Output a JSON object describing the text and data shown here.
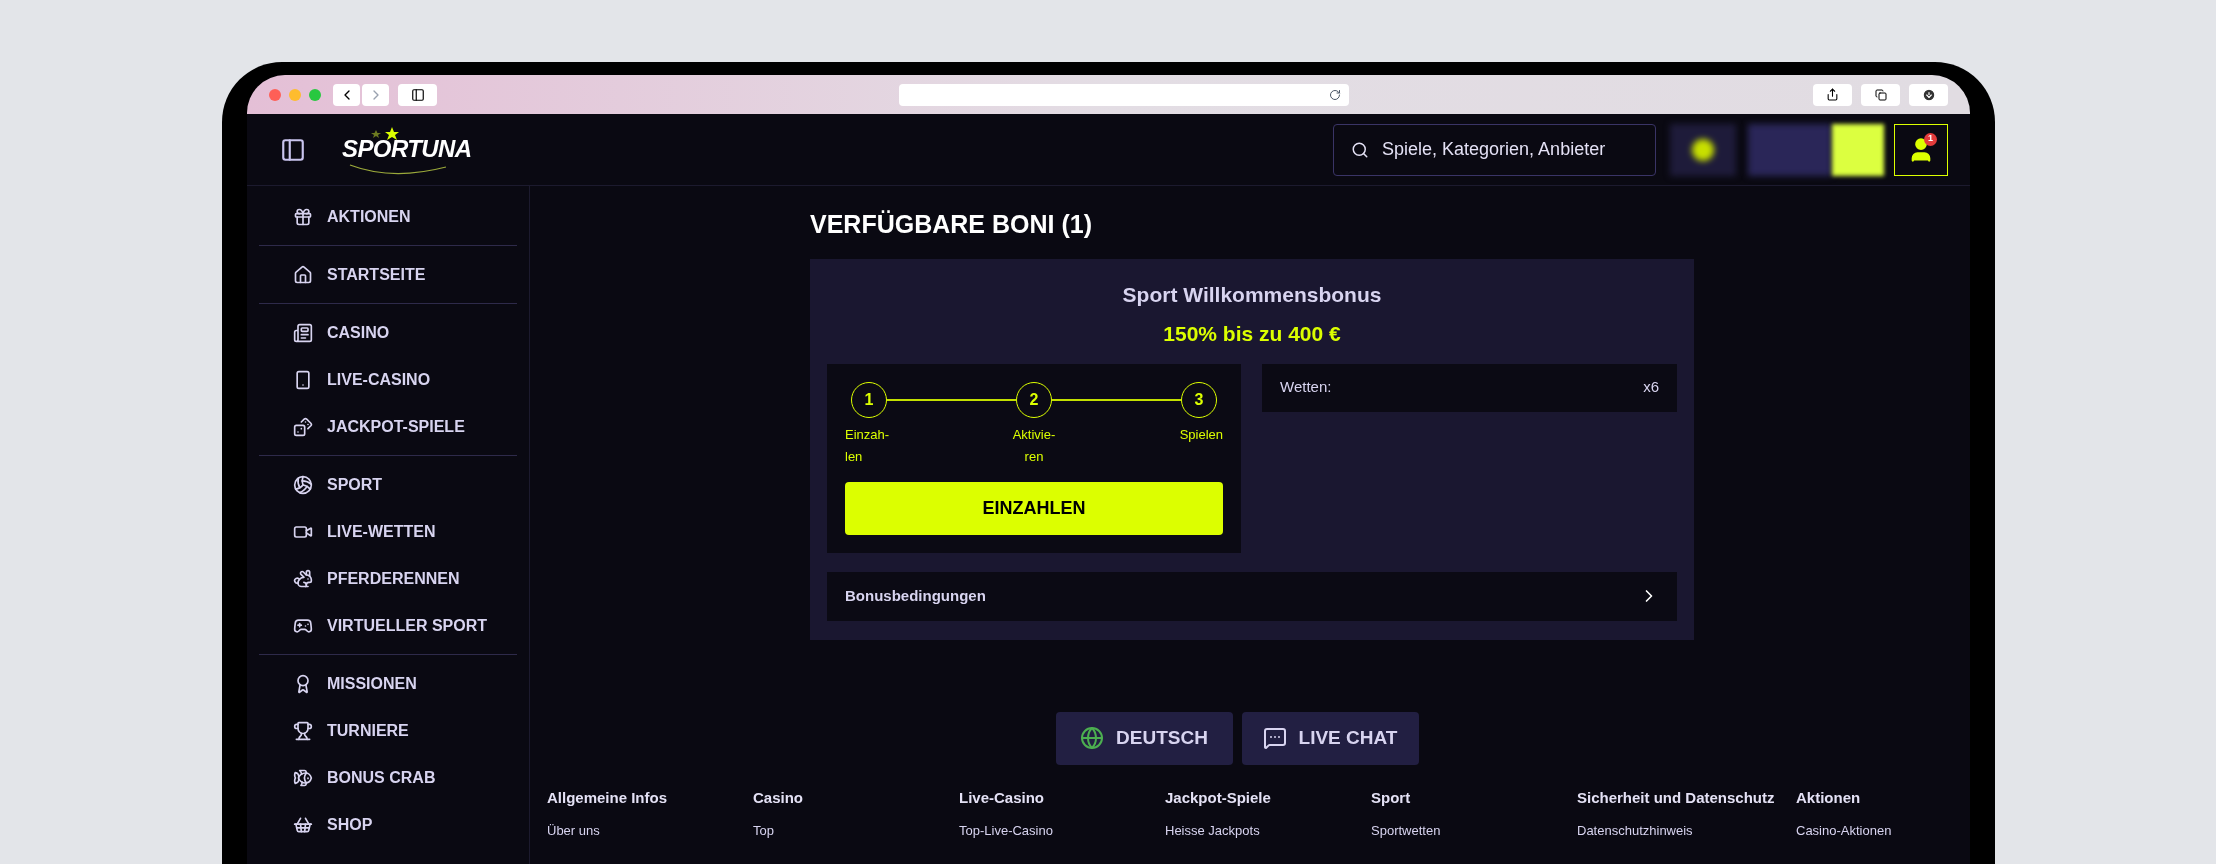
{
  "header": {
    "logo": "SPORTUNA",
    "search": {
      "placeholder": "Spiele, Kategorien, Anbieter"
    },
    "notification_count": "1"
  },
  "sidebar": {
    "groups": [
      {
        "items": [
          {
            "label": "AKTIONEN"
          }
        ]
      },
      {
        "items": [
          {
            "label": "STARTSEITE"
          }
        ]
      },
      {
        "items": [
          {
            "label": "CASINO"
          },
          {
            "label": "LIVE-CASINO"
          },
          {
            "label": "JACKPOT-SPIELE"
          }
        ]
      },
      {
        "items": [
          {
            "label": "SPORT"
          },
          {
            "label": "LIVE-WETTEN"
          },
          {
            "label": "PFERDERENNEN"
          },
          {
            "label": "VIRTUELLER SPORT"
          }
        ]
      },
      {
        "items": [
          {
            "label": "MISSIONEN"
          },
          {
            "label": "TURNIERE"
          },
          {
            "label": "BONUS CRAB"
          },
          {
            "label": "SHOP"
          }
        ]
      }
    ]
  },
  "main": {
    "title": "VERFÜGBARE BONI (1)",
    "bonus": {
      "name": "Sport Willkommensbonus",
      "offer": "150% bis zu 400 €",
      "steps": [
        {
          "number": "1",
          "label": "Einzah-len"
        },
        {
          "number": "2",
          "label": "Aktivie-ren"
        },
        {
          "number": "3",
          "label": "Spielen"
        }
      ],
      "button": "EINZAHLEN",
      "wager_label": "Wetten:",
      "wager_value": "x6",
      "terms": "Bonusbedingungen"
    }
  },
  "footer": {
    "buttons": [
      {
        "kind": "language",
        "label": "DEUTSCH"
      },
      {
        "kind": "chat",
        "label": "LIVE CHAT"
      }
    ],
    "columns": [
      {
        "heading": "Allgemeine Infos",
        "links": [
          "Über uns"
        ]
      },
      {
        "heading": "Casino",
        "links": [
          "Top"
        ]
      },
      {
        "heading": "Live-Casino",
        "links": [
          "Top-Live-Casino"
        ]
      },
      {
        "heading": "Jackpot-Spiele",
        "links": [
          "Heisse Jackpots"
        ]
      },
      {
        "heading": "Sport",
        "links": [
          "Sportwetten"
        ]
      },
      {
        "heading": "Sicherheit und Datenschutz",
        "links": [
          "Datenschutzhinweis"
        ]
      },
      {
        "heading": "Aktionen",
        "links": [
          "Casino-Aktionen"
        ]
      }
    ]
  }
}
